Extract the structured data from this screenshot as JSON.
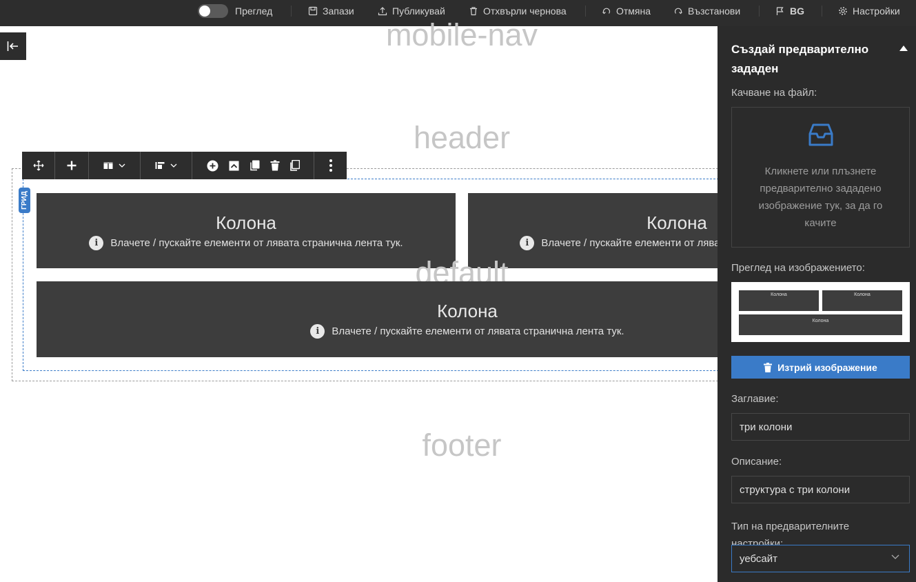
{
  "topbar": {
    "preview_label": "Преглед",
    "save_label": "Запази",
    "publish_label": "Публикувай",
    "discard_label": "Отхвърли чернова",
    "undo_label": "Отмяна",
    "redo_label": "Възстанови",
    "language_label": "BG",
    "settings_label": "Настройки"
  },
  "canvas": {
    "mobile_nav_label": "mobile-nav",
    "header_label": "header",
    "default_label": "default",
    "footer_label": "footer",
    "grid_tag": "ГРИД",
    "columns": [
      {
        "title": "Колона",
        "hint": "Влачете / пускайте елементи от лявата странична лента тук."
      },
      {
        "title": "Колона",
        "hint": "Влачете / пускайте елементи от лявата странична лента тук."
      },
      {
        "title": "Колона",
        "hint": "Влачете / пускайте елементи от лявата странична лента тук."
      }
    ]
  },
  "panel": {
    "title": "Създай предварително зададен",
    "upload_label": "Качване на файл:",
    "upload_hint": "Кликнете или плъзнете предварително зададено изображение тук, за да го качите",
    "preview_label": "Преглед на изображението:",
    "delete_image_label": "Изтрий изображение",
    "title_label": "Заглавие:",
    "title_value": "три колони",
    "description_label": "Описание:",
    "description_value": "структура с три колони",
    "type_label": "Тип на предварителните настройки:",
    "type_value": "уебсайт"
  },
  "colors": {
    "accent": "#3a7bc8",
    "dark_bg": "#2d2d2d",
    "column_bg": "#3d3d3d"
  }
}
